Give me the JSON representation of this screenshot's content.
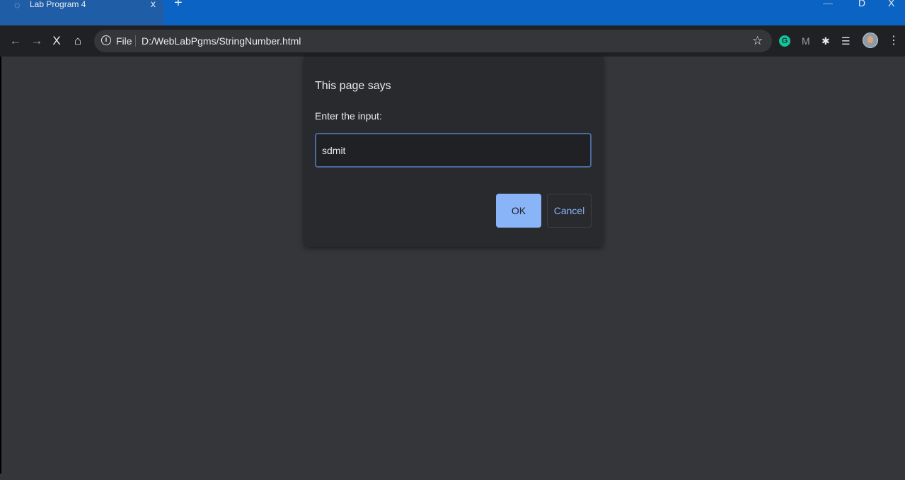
{
  "tab": {
    "title": "Lab Program 4",
    "close": "x",
    "new_tab": "+"
  },
  "window_controls": {
    "minimize": "—",
    "restore": "D",
    "close": "X"
  },
  "toolbar": {
    "back_icon": "←",
    "forward_icon": "→",
    "stop_icon": "X",
    "home_icon": "⌂"
  },
  "omnibox": {
    "info_glyph": "i",
    "scheme_label": "File",
    "url": "D:/WebLabPgms/StringNumber.html"
  },
  "extensions": {
    "star": "☆",
    "grammarly": "G",
    "metamask": "M",
    "puzzle": "✱",
    "reading_list": "☰",
    "menu": "⋮"
  },
  "dialog": {
    "title": "This page says",
    "message": "Enter the input:",
    "input_value": "sdmit",
    "ok_label": "OK",
    "cancel_label": "Cancel"
  },
  "colors": {
    "tabstrip": "#0b63c4",
    "toolbar": "#202124",
    "page_bg": "#35363a",
    "dialog_bg": "#292a2d",
    "accent": "#8ab4f8"
  }
}
